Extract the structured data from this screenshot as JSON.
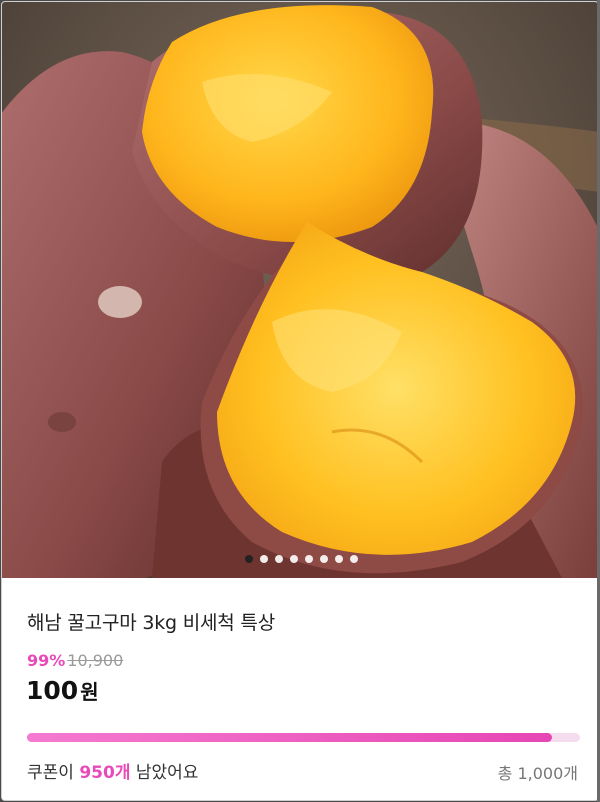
{
  "product": {
    "title": "해남 꿀고구마 3kg 비세척 특상",
    "discount": "99%",
    "original_price": "10,900",
    "price": "100",
    "price_unit": "원",
    "image_name": "baked-sweet-potato-image"
  },
  "carousel": {
    "dot_count": 8,
    "active_index": 0
  },
  "coupon": {
    "prefix": "쿠폰이 ",
    "remaining": "950개",
    "suffix": " 남았어요",
    "total": "총 1,000개",
    "progress_fraction": 0.95
  },
  "colors": {
    "accent": "#e84bb8",
    "progress_track": "#f6dcef"
  }
}
